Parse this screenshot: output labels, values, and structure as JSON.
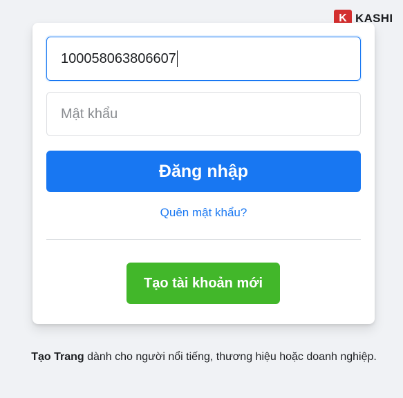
{
  "watermark": {
    "letter": "K",
    "name": "KASHI"
  },
  "login_form": {
    "email_value": "100058063806607",
    "password_placeholder": "Mật khẩu",
    "login_button_label": "Đăng nhập",
    "forgot_password_link": "Quên mật khẩu?",
    "create_account_button_label": "Tạo tài khoản mới"
  },
  "footer": {
    "create_page_link": "Tạo Trang",
    "create_page_text": " dành cho người nổi tiếng, thương hiệu hoặc doanh nghiệp."
  },
  "colors": {
    "primary": "#1877f2",
    "success": "#42b72a",
    "background": "#f0f2f5",
    "watermark": "#d32f2f"
  }
}
